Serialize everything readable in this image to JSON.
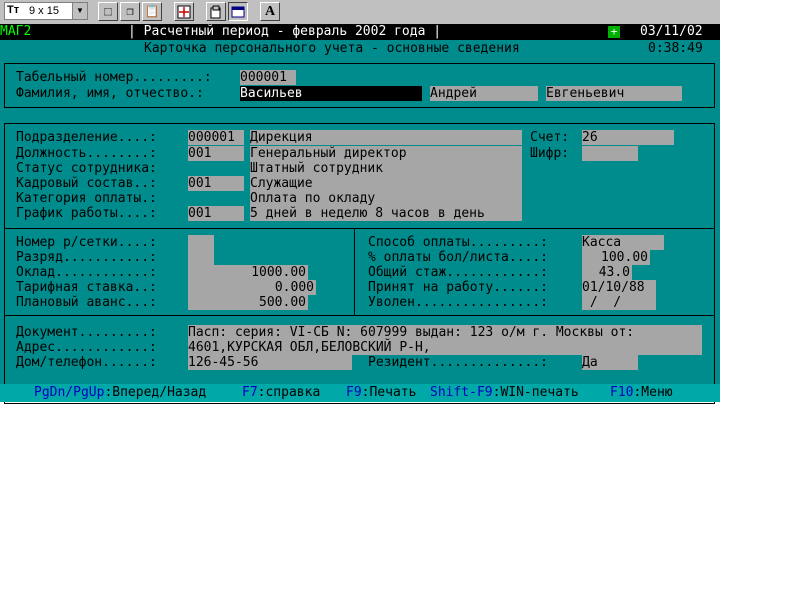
{
  "toolbar": {
    "font_prefix": "Tт",
    "font_size": "9 x 15",
    "buttons": [
      "select-icon",
      "copy-icon",
      "paste-icon",
      "fullscreen-icon",
      "properties-icon",
      "background-icon",
      "font-icon"
    ],
    "font_button_label": "A"
  },
  "header": {
    "app_label": "МАГ2",
    "period": "| Расчетный период - февраль 2002 года |",
    "plus": "+",
    "date": "03/11/02",
    "title": "Карточка персонального учета - основные сведения",
    "time": "0:38:49"
  },
  "identity": {
    "tab_label": "Табельный номер.........:",
    "tab_value": "000001",
    "name_label": "Фамилия, имя, отчество.:",
    "surname": "Васильев",
    "first_name": "Андрей",
    "patronymic": "Евгеньевич"
  },
  "job": {
    "dept_label": "Подразделение....:",
    "dept_code": "000001",
    "dept_name": "Дирекция",
    "pos_label": "Должность........:",
    "pos_code": "001",
    "pos_name": "Генеральный директор",
    "status_label": "Статус сотрудника:",
    "status_value": "Штатный сотрудник",
    "staff_label": "Кадровый состав..:",
    "staff_code": "001",
    "staff_value": "Служащие",
    "pay_cat_label": "Категория оплаты.:",
    "pay_cat_value": "Оплата по окладу",
    "schedule_label": "График работы....:",
    "schedule_code": "001",
    "schedule_value": "5 дней в неделю 8 часов в день",
    "account_label": "Счет:",
    "account_value": "26",
    "cipher_label": "Шифр:",
    "cipher_value": ""
  },
  "salary": {
    "grid_label": "Номер р/сетки....:",
    "grid_value": "",
    "rank_label": "Разряд...........:",
    "rank_value": "",
    "salary_label": "Оклад............:",
    "salary_value": "1000.00",
    "rate_label": "Тарифная ставка..:",
    "rate_value": "0.000",
    "advance_label": "Плановый аванс...:",
    "advance_value": "500.00"
  },
  "payment": {
    "method_label": "Способ оплаты.........:",
    "method_value": "Касса",
    "sick_label": "% оплаты бол/листа....:",
    "sick_value": "100.00",
    "tenure_label": "Общий стаж............:",
    "tenure_value": "43.0",
    "hired_label": "Принят на работу......:",
    "hired_value": "01/10/88",
    "fired_label": "Уволен................:",
    "fired_value": " /  /"
  },
  "contacts": {
    "doc_label": "Документ.........:",
    "doc_value": "Пасп: серия: VI-СБ N: 607999 выдан: 123 о/м г. Москвы от:",
    "addr_label": "Адрес............:",
    "addr_value": "4601,КУРСКАЯ ОБЛ,БЕЛОВСКИЙ Р-Н,",
    "phone_label": "Дом/телефон......:",
    "phone_value": "126-45-56",
    "resident_label": "Резидент..............:",
    "resident_value": "Да"
  },
  "keys": [
    {
      "key": "PgDn/PgUp",
      "text": ":Вперед/Назад "
    },
    {
      "key": "F7",
      "text": ":справка "
    },
    {
      "key": "F9",
      "text": ":Печать "
    },
    {
      "key": "Shift-F9",
      "text": ":WIN-печать "
    },
    {
      "key": "F10",
      "text": ":Меню"
    }
  ],
  "colors": {
    "background": "#008c8c",
    "field": "#a6a6a6",
    "key": "#0000c0",
    "status_green": "#00ff00"
  }
}
